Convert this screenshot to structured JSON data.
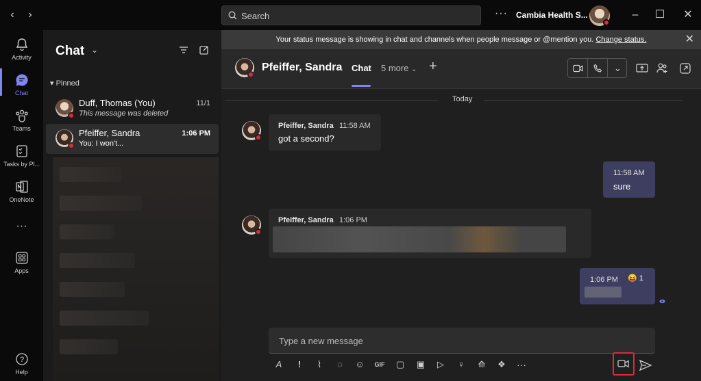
{
  "titlebar": {
    "search_placeholder": "Search",
    "more_label": "···",
    "org_name": "Cambia Health S...",
    "back_icon": "chevron-left-icon",
    "forward_icon": "chevron-right-icon"
  },
  "rail": {
    "items": [
      {
        "label": "Activity",
        "icon": "bell-icon"
      },
      {
        "label": "Chat",
        "icon": "chat-icon"
      },
      {
        "label": "Teams",
        "icon": "teams-icon"
      },
      {
        "label": "Tasks by Pl...",
        "icon": "tasks-icon"
      },
      {
        "label": "OneNote",
        "icon": "onenote-icon"
      },
      {
        "label": "···",
        "icon": "more-icon"
      },
      {
        "label": "Apps",
        "icon": "apps-icon"
      },
      {
        "label": "Help",
        "icon": "help-icon"
      }
    ]
  },
  "list": {
    "title": "Chat",
    "pinned_label": "Pinned",
    "chats": [
      {
        "name": "Duff, Thomas (You)",
        "preview": "This message was deleted",
        "time": "11/1"
      },
      {
        "name": "Pfeiffer, Sandra",
        "preview": "You: I won't...",
        "time": "1:06 PM"
      }
    ]
  },
  "banner": {
    "text": "Your status message is showing in chat and channels when people message or @mention you.",
    "link": "Change status."
  },
  "header": {
    "name": "Pfeiffer, Sandra",
    "tab_chat": "Chat",
    "tab_more": "5 more",
    "add_tab": "+"
  },
  "conversation": {
    "day_label": "Today",
    "messages": [
      {
        "direction": "in",
        "sender": "Pfeiffer, Sandra",
        "time": "11:58 AM",
        "text": "got a second?"
      },
      {
        "direction": "out",
        "time": "11:58 AM",
        "text": "sure"
      },
      {
        "direction": "in",
        "sender": "Pfeiffer, Sandra",
        "time": "1:06 PM",
        "text": ""
      },
      {
        "direction": "out",
        "time": "1:06 PM",
        "text": "",
        "reaction": "😝",
        "reaction_count": "1"
      }
    ]
  },
  "composer": {
    "placeholder": "Type a new message"
  },
  "colors": {
    "accent": "#7f85f5",
    "presence_busy": "#d92c3b",
    "outgoing_bubble": "#3e3e60"
  }
}
